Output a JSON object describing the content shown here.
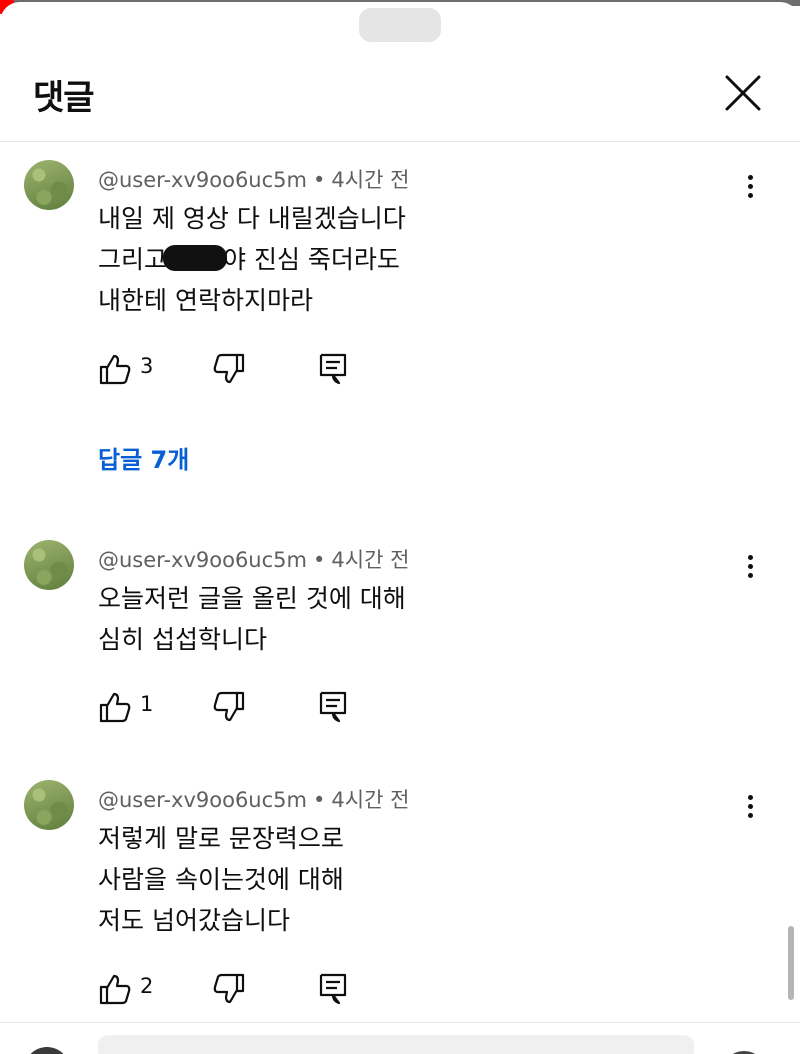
{
  "panel": {
    "title": "댓글"
  },
  "comments": [
    {
      "author": "@user-xv9oo6uc5m",
      "time": "4시간 전",
      "lines": [
        "내일 제 영상 다   내릴겠습니다",
        "그리고",
        "야 진심 죽더라도",
        "내한테 연락하지마라"
      ],
      "likes": "3",
      "replies": "답글 7개"
    },
    {
      "author": "@user-xv9oo6uc5m",
      "time": "4시간 전",
      "lines": [
        "오늘저런 글을 올린 것에 대해",
        "심히 섭섭학니다"
      ],
      "likes": "1"
    },
    {
      "author": "@user-xv9oo6uc5m",
      "time": "4시간 전",
      "lines": [
        "저렇게 말로 문장력으로",
        "사람을 속이는것에 대해",
        "저도 넘어갔습니다"
      ],
      "likes": "2"
    }
  ],
  "colors": {
    "link": "#065fd4",
    "text": "#0f0f0f",
    "meta": "#606060"
  },
  "icons": [
    "close-icon",
    "more-vert-icon",
    "thumb-up-icon",
    "thumb-down-icon",
    "reply-icon"
  ]
}
